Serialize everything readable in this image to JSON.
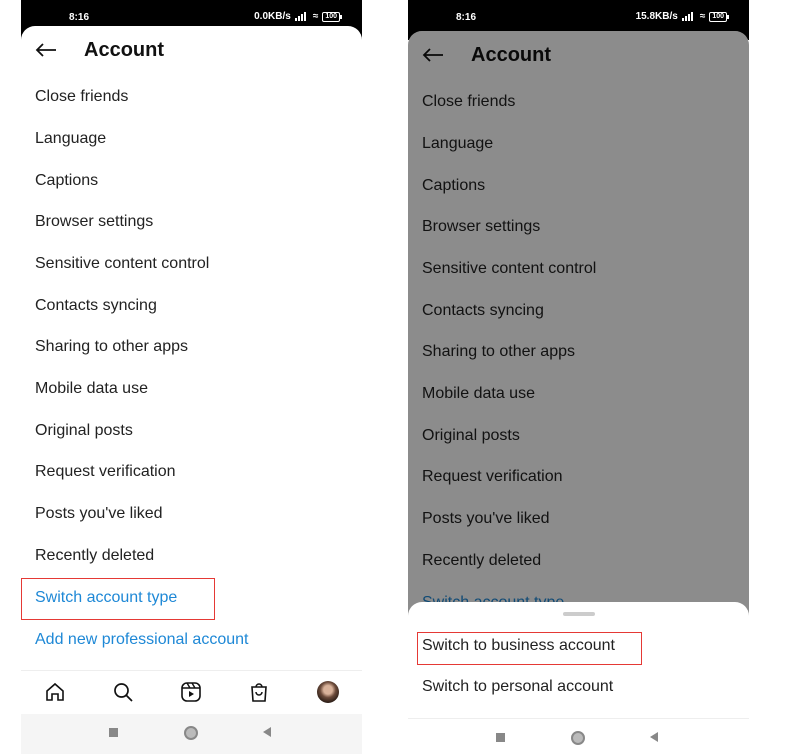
{
  "left": {
    "status": {
      "time": "8:16",
      "speed": "0.0KB/s",
      "battery": "100"
    },
    "header": {
      "title": "Account"
    },
    "items": [
      "Close friends",
      "Language",
      "Captions",
      "Browser settings",
      "Sensitive content control",
      "Contacts syncing",
      "Sharing to other apps",
      "Mobile data use",
      "Original posts",
      "Request verification",
      "Posts you've liked",
      "Recently deleted"
    ],
    "links": [
      "Switch account type",
      "Add new professional account"
    ]
  },
  "right": {
    "status": {
      "time": "8:16",
      "speed": "15.8KB/s",
      "battery": "100"
    },
    "header": {
      "title": "Account"
    },
    "items": [
      "Close friends",
      "Language",
      "Captions",
      "Browser settings",
      "Sensitive content control",
      "Contacts syncing",
      "Sharing to other apps",
      "Mobile data use",
      "Original posts",
      "Request verification",
      "Posts you've liked",
      "Recently deleted"
    ],
    "partial_link": "Switch account type",
    "sheet": {
      "options": [
        "Switch to business account",
        "Switch to personal account"
      ]
    }
  },
  "colors": {
    "link": "#1e88d6",
    "highlight": "#e53935"
  },
  "icons": [
    "back-arrow-icon",
    "home-icon",
    "search-icon",
    "reels-icon",
    "shop-icon",
    "profile-avatar"
  ]
}
